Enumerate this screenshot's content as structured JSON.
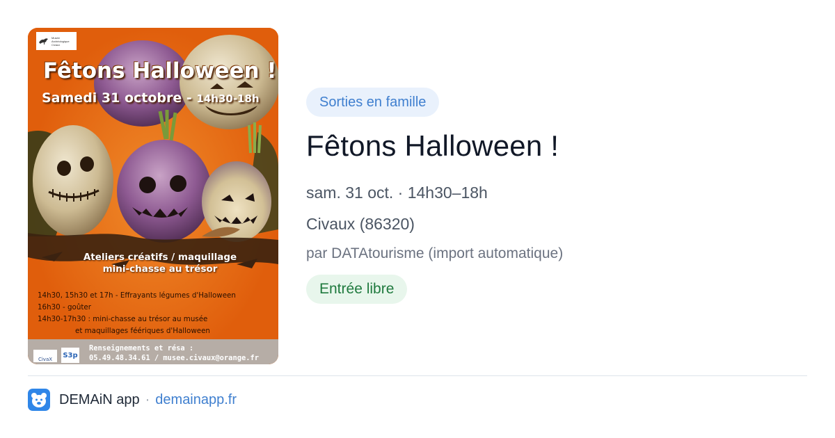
{
  "poster": {
    "museum_logo_text": "Musée\nArchéologique\nCivaux",
    "title": "Fêtons Halloween !",
    "date_main": "Samedi 31 octobre - ",
    "date_time": "14h30-18h",
    "activities": "Ateliers créatifs / maquillage\nmini-chasse au trésor",
    "schedule": [
      "14h30, 15h30 et 17h - Effrayants légumes d'Halloween",
      "16h30 - goûter",
      "14h30-17h30 : mini-chasse au trésor au musée",
      "et  maquillages féériques d'Halloween"
    ],
    "contact_label": "Renseignements et résa :",
    "contact_details": "05.49.48.34.61 / musee.civaux@orange.fr",
    "badge_civaux": "CivaX",
    "badge_logo": "S3p"
  },
  "event": {
    "category": "Sorties en famille",
    "title": "Fêtons Halloween !",
    "when": "sam. 31 oct. · 14h30–18h",
    "where": "Civaux (86320)",
    "source": "par DATAtourisme (import automatique)",
    "price": "Entrée libre"
  },
  "footer": {
    "app_name": "DEMAiN app",
    "separator": "·",
    "link": "demainapp.fr",
    "icon": "bear-face-icon"
  },
  "colors": {
    "poster_orange": "#ec6a12",
    "category_bg": "#e9f1fc",
    "category_text": "#3f7fcf",
    "price_bg": "#e8f6ec",
    "price_text": "#1f7a3e",
    "app_icon_bg": "#2f86e8",
    "link": "#3f7fcf"
  }
}
